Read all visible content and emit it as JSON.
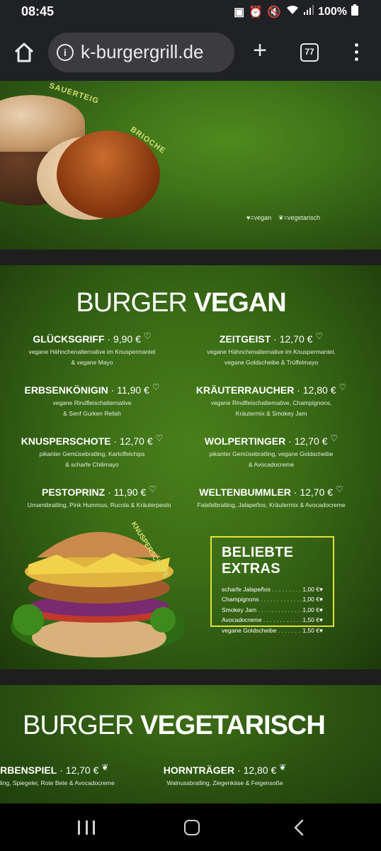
{
  "status": {
    "time": "08:45",
    "battery": "100%"
  },
  "browser": {
    "url": "k-burgergrill.de",
    "tab_count": "77"
  },
  "banner1": {
    "label_sauerteig": "SAUERTEIG",
    "label_brioche": "BRIOCHE",
    "legend_vegan": "=vegan",
    "legend_vegetarisch": "=vegetarisch"
  },
  "vegan": {
    "title_thin": "BURGER",
    "title_bold": "VEGAN",
    "items": [
      {
        "name": "GLÜCKSGRIFF",
        "price": "9,90 €",
        "desc1": "vegane Hähnchenalternative im Knuspermantel",
        "desc2": "& vegane Mayo"
      },
      {
        "name": "ZEITGEIST",
        "price": "12,70 €",
        "desc1": "vegane Hähnchenalternative im Knuspermantel,",
        "desc2": "vegane Goldscheibe & Trüffelmayo"
      },
      {
        "name": "ERBSENKÖNIGIN",
        "price": "11,90 €",
        "desc1": "vegane Rindfleischalternative",
        "desc2": "& Senf Gurken Relish"
      },
      {
        "name": "KRÄUTERRAUCHER",
        "price": "12,80 €",
        "desc1": "vegane Rindfleischalternative, Champignons,",
        "desc2": "Kräutermix & Smokey Jam"
      },
      {
        "name": "KNUSPERSCHOTE",
        "price": "12,70 €",
        "desc1": "pikanter Gemüsebratling, Kartoffelchips",
        "desc2": "& scharfe Chilimayo"
      },
      {
        "name": "WOLPERTINGER",
        "price": "12,70 €",
        "desc1": "pikanter Gemüsebratling, vegane Goldscheibe",
        "desc2": "& Avocadocreme"
      },
      {
        "name": "PESTOPRINZ",
        "price": "11,90 €",
        "desc1": "Umamibratling, Pink Hummus, Rucola & Kräuterpesto",
        "desc2": ""
      },
      {
        "name": "WELTENBUMMLER",
        "price": "12,70 €",
        "desc1": "Falafelbratling, Jalapeños, Kräutermix & Avocadocreme",
        "desc2": ""
      }
    ],
    "burger_label": "KNUSPERSCHOTE",
    "extras": {
      "title": "BELIEBTE EXTRAS",
      "rows": [
        {
          "name": "scharfe Jalapeños",
          "price": "1,00 €"
        },
        {
          "name": "Champignons",
          "price": "1,00 €"
        },
        {
          "name": "Smokey Jam",
          "price": "1,00 €"
        },
        {
          "name": "Avocadocreme",
          "price": "1,50 €"
        },
        {
          "name": "vegane Goldscheibe",
          "price": "1,50 €"
        }
      ]
    }
  },
  "vegetarisch": {
    "title_thin": "BURGER",
    "title_bold": "VEGETARISCH",
    "items": [
      {
        "name": "ARBENSPIEL",
        "price": "12,70 €",
        "desc1": "ratling, Spiegelei, Rote Bete & Avocadocreme"
      },
      {
        "name": "HORNTRÄGER",
        "price": "12,80 €",
        "desc1": "Walnussbratling, Ziegenkäse & Feigensoße"
      }
    ]
  },
  "colors": {
    "accent_yellow": "#e1e235",
    "label_yellow": "#d7de6f",
    "green_dark": "#1f400c",
    "green_light": "#4f8a1e",
    "browser_bar": "#202124"
  }
}
